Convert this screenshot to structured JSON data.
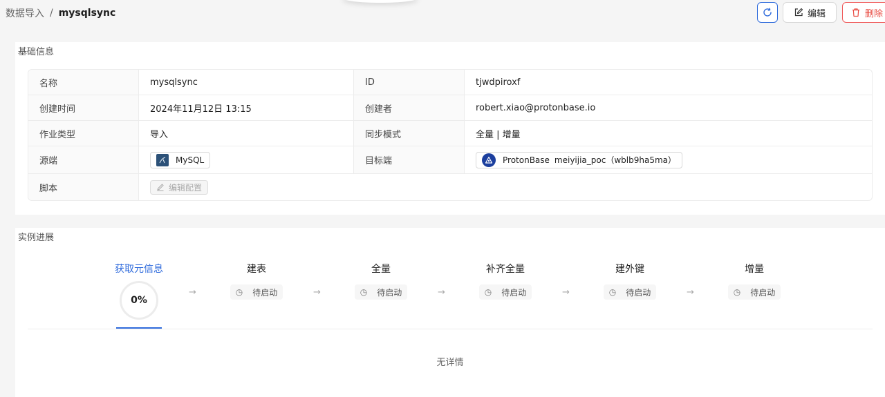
{
  "breadcrumb": {
    "parent": "数据导入",
    "separator": "/",
    "current": "mysqlsync"
  },
  "toolbar": {
    "edit_label": "编辑",
    "delete_label": "删除"
  },
  "colors": {
    "accent": "#2f6bdc",
    "danger": "#e8483f"
  },
  "basic_info": {
    "title": "基础信息",
    "rows": [
      {
        "label1": "名称",
        "value1": "mysqlsync",
        "label2": "ID",
        "value2": "tjwdpiroxf"
      },
      {
        "label1": "创建时间",
        "value1": "2024年11月12日 13:15",
        "label2": "创建者",
        "value2": "robert.xiao@protonbase.io"
      },
      {
        "label1": "作业类型",
        "value1": "导入",
        "label2": "同步模式",
        "value2": "全量 | 增量"
      },
      {
        "label1": "源端",
        "source_label": "MySQL",
        "label2": "目标端",
        "target_product": "ProtonBase",
        "target_instance": "meiyijia_poc（wblb9ha5ma）"
      },
      {
        "label1": "脚本",
        "script_button": "编辑配置"
      }
    ]
  },
  "progress": {
    "title": "实例进展",
    "steps": [
      {
        "name": "获取元信息",
        "progress": "0%"
      },
      {
        "name": "建表",
        "status": "待启动"
      },
      {
        "name": "全量",
        "status": "待启动"
      },
      {
        "name": "补齐全量",
        "status": "待启动"
      },
      {
        "name": "建外键",
        "status": "待启动"
      },
      {
        "name": "增量",
        "status": "待启动"
      }
    ],
    "empty_text": "无详情"
  }
}
